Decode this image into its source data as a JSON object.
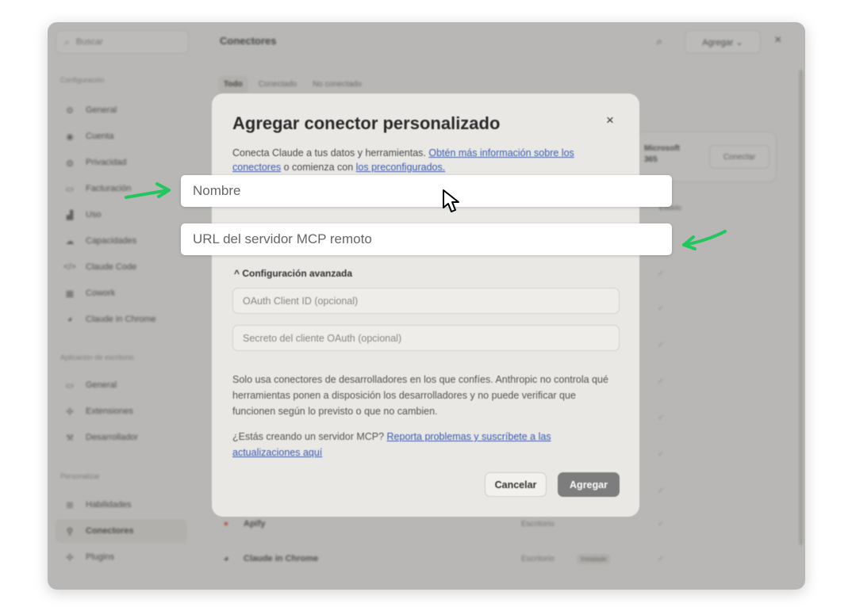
{
  "sidebar": {
    "search_placeholder": "Buscar",
    "sections": [
      "Configuración",
      "Aplicación de escritorio",
      "Personalizar"
    ],
    "items_config": [
      {
        "label": "General",
        "icon": "gear-icon"
      },
      {
        "label": "Cuenta",
        "icon": "user-icon"
      },
      {
        "label": "Privacidad",
        "icon": "shield-icon"
      },
      {
        "label": "Facturación",
        "icon": "card-icon"
      },
      {
        "label": "Uso",
        "icon": "chart-icon"
      },
      {
        "label": "Capacidades",
        "icon": "cloud-icon"
      },
      {
        "label": "Claude Code",
        "icon": "code-icon"
      },
      {
        "label": "Cowork",
        "icon": "grid-icon"
      },
      {
        "label": "Claude in Chrome",
        "icon": "chrome-icon"
      }
    ],
    "items_desktop": [
      {
        "label": "General",
        "icon": "monitor-icon"
      },
      {
        "label": "Extensiones",
        "icon": "puzzle-icon"
      },
      {
        "label": "Desarrollador",
        "icon": "wrench-icon"
      }
    ],
    "items_custom": [
      {
        "label": "Habilidades",
        "icon": "skills-icon"
      },
      {
        "label": "Conectores",
        "icon": "plug-icon"
      },
      {
        "label": "Plugins",
        "icon": "puzzle-icon"
      }
    ]
  },
  "main": {
    "title": "Conectores",
    "add_label": "Agregar ⌄",
    "close": "×",
    "tabs": [
      "Todo",
      "Conectado",
      "No conectado"
    ],
    "featured": {
      "name": "Microsoft 365",
      "button": "Conectar"
    },
    "status_header": "Estado",
    "rows": [
      {
        "icon": "apify-icon",
        "name": "Apify",
        "type": "Escritorio",
        "badge": ""
      },
      {
        "icon": "chrome-icon",
        "name": "Claude in Chrome",
        "type": "Escritorio",
        "badge": "Instalado"
      }
    ]
  },
  "modal": {
    "title": "Agregar conector personalizado",
    "close": "×",
    "desc_1": "Conecta Claude a tus datos y herramientas. ",
    "desc_link_1": "Obtén más información sobre los conectores",
    "desc_2": " o comienza con ",
    "desc_link_2": "los preconfigurados.",
    "advanced_label": "^ Configuración avanzada",
    "oauth_id_placeholder": "OAuth Client ID (opcional)",
    "oauth_secret_placeholder": "Secreto del cliente OAuth (opcional)",
    "note": "Solo usa conectores de desarrolladores en los que confíes. Anthropic no controla qué herramientas ponen a disposición los desarrolladores y no puede verificar que funcionen según lo previsto o que no cambien.",
    "note2_prefix": "¿Estás creando un servidor MCP? ",
    "note2_link": "Reporta problemas y suscríbete a las actualizaciones aquí",
    "cancel": "Cancelar",
    "add": "Agregar"
  },
  "highlight": {
    "name_placeholder": "Nombre",
    "url_placeholder": "URL del servidor MCP remoto"
  },
  "colors": {
    "arrow": "#22c55e",
    "link": "#3a5cb0"
  }
}
